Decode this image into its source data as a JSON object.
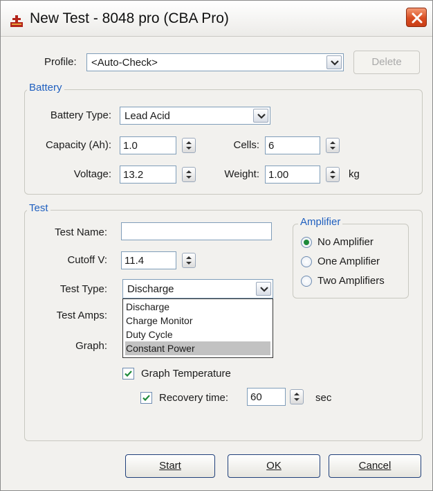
{
  "window": {
    "title": "New Test - 8048 pro (CBA Pro)"
  },
  "profile": {
    "label": "Profile:",
    "value": "<Auto-Check>",
    "delete_label": "Delete"
  },
  "battery": {
    "legend": "Battery",
    "type_label": "Battery Type:",
    "type_value": "Lead Acid",
    "capacity_label": "Capacity (Ah):",
    "capacity_value": "1.0",
    "cells_label": "Cells:",
    "cells_value": "6",
    "voltage_label": "Voltage:",
    "voltage_value": "13.2",
    "weight_label": "Weight:",
    "weight_value": "1.00",
    "weight_unit": "kg"
  },
  "test": {
    "legend": "Test",
    "name_label": "Test Name:",
    "name_value": "",
    "cutoff_label": "Cutoff V:",
    "cutoff_value": "11.4",
    "type_label": "Test Type:",
    "type_value": "Discharge",
    "amps_label": "Test Amps:",
    "graph_label": "Graph:",
    "type_options": [
      "Discharge",
      "Charge Monitor",
      "Duty Cycle",
      "Constant Power"
    ],
    "selected_option": "Constant Power",
    "graph_temperature_label": "Graph Temperature",
    "graph_temperature_checked": true,
    "recovery_label": "Recovery time:",
    "recovery_value": "60",
    "recovery_unit": "sec",
    "recovery_checked": true
  },
  "amplifier": {
    "legend": "Amplifier",
    "options": [
      "No Amplifier",
      "One Amplifier",
      "Two Amplifiers"
    ],
    "selected": "No Amplifier"
  },
  "buttons": {
    "start": "Start",
    "ok": "OK",
    "cancel": "Cancel"
  },
  "colors": {
    "legend": "#1f5fbf",
    "close_button": "#d94d22",
    "radio_dot": "#1e8a3a",
    "list_selection": "#c2c2c2"
  }
}
